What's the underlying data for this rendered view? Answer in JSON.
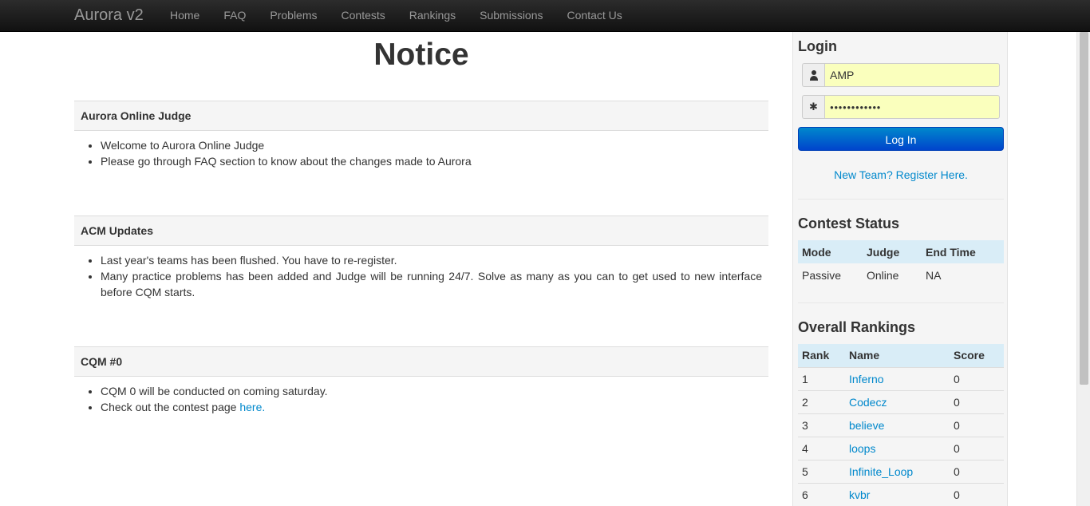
{
  "navbar": {
    "brand": "Aurora v2",
    "items": [
      "Home",
      "FAQ",
      "Problems",
      "Contests",
      "Rankings",
      "Submissions",
      "Contact Us"
    ]
  },
  "main": {
    "title": "Notice",
    "sections": [
      {
        "heading": "Aurora Online Judge",
        "items": [
          "Welcome to Aurora Online Judge",
          "Please go through FAQ section to know about the changes made to Aurora"
        ]
      },
      {
        "heading": "ACM Updates",
        "items": [
          "Last year's teams has been flushed. You have to re-register.",
          "Many practice problems has been added and Judge will be running 24/7. Solve as many as you can to get used to new interface before CQM starts."
        ]
      },
      {
        "heading": "CQM #0",
        "items": [
          "CQM 0 will be conducted on coming saturday.",
          "Check out the contest page "
        ],
        "link_text": "here."
      }
    ]
  },
  "sidebar": {
    "login": {
      "title": "Login",
      "username_value": "AMP",
      "password_value": "●●●●●●●●●●●●",
      "button_label": "Log In",
      "register_link": "New Team? Register Here."
    },
    "contest_status": {
      "title": "Contest Status",
      "headers": [
        "Mode",
        "Judge",
        "End Time"
      ],
      "row": [
        "Passive",
        "Online",
        "NA"
      ]
    },
    "rankings": {
      "title": "Overall Rankings",
      "headers": [
        "Rank",
        "Name",
        "Score"
      ],
      "rows": [
        {
          "rank": "1",
          "name": "Inferno",
          "score": "0"
        },
        {
          "rank": "2",
          "name": "Codecz",
          "score": "0"
        },
        {
          "rank": "3",
          "name": "believe",
          "score": "0"
        },
        {
          "rank": "4",
          "name": "loops",
          "score": "0"
        },
        {
          "rank": "5",
          "name": "Infinite_Loop",
          "score": "0"
        },
        {
          "rank": "6",
          "name": "kvbr",
          "score": "0"
        }
      ]
    }
  },
  "icons": {
    "username": "user-icon",
    "password": "asterisk-icon"
  },
  "colors": {
    "navbar": "#1b1b1b",
    "link": "#0088cc",
    "button": "#0066cc",
    "autofill": "#faffbd",
    "table_header": "#d9edf7"
  }
}
